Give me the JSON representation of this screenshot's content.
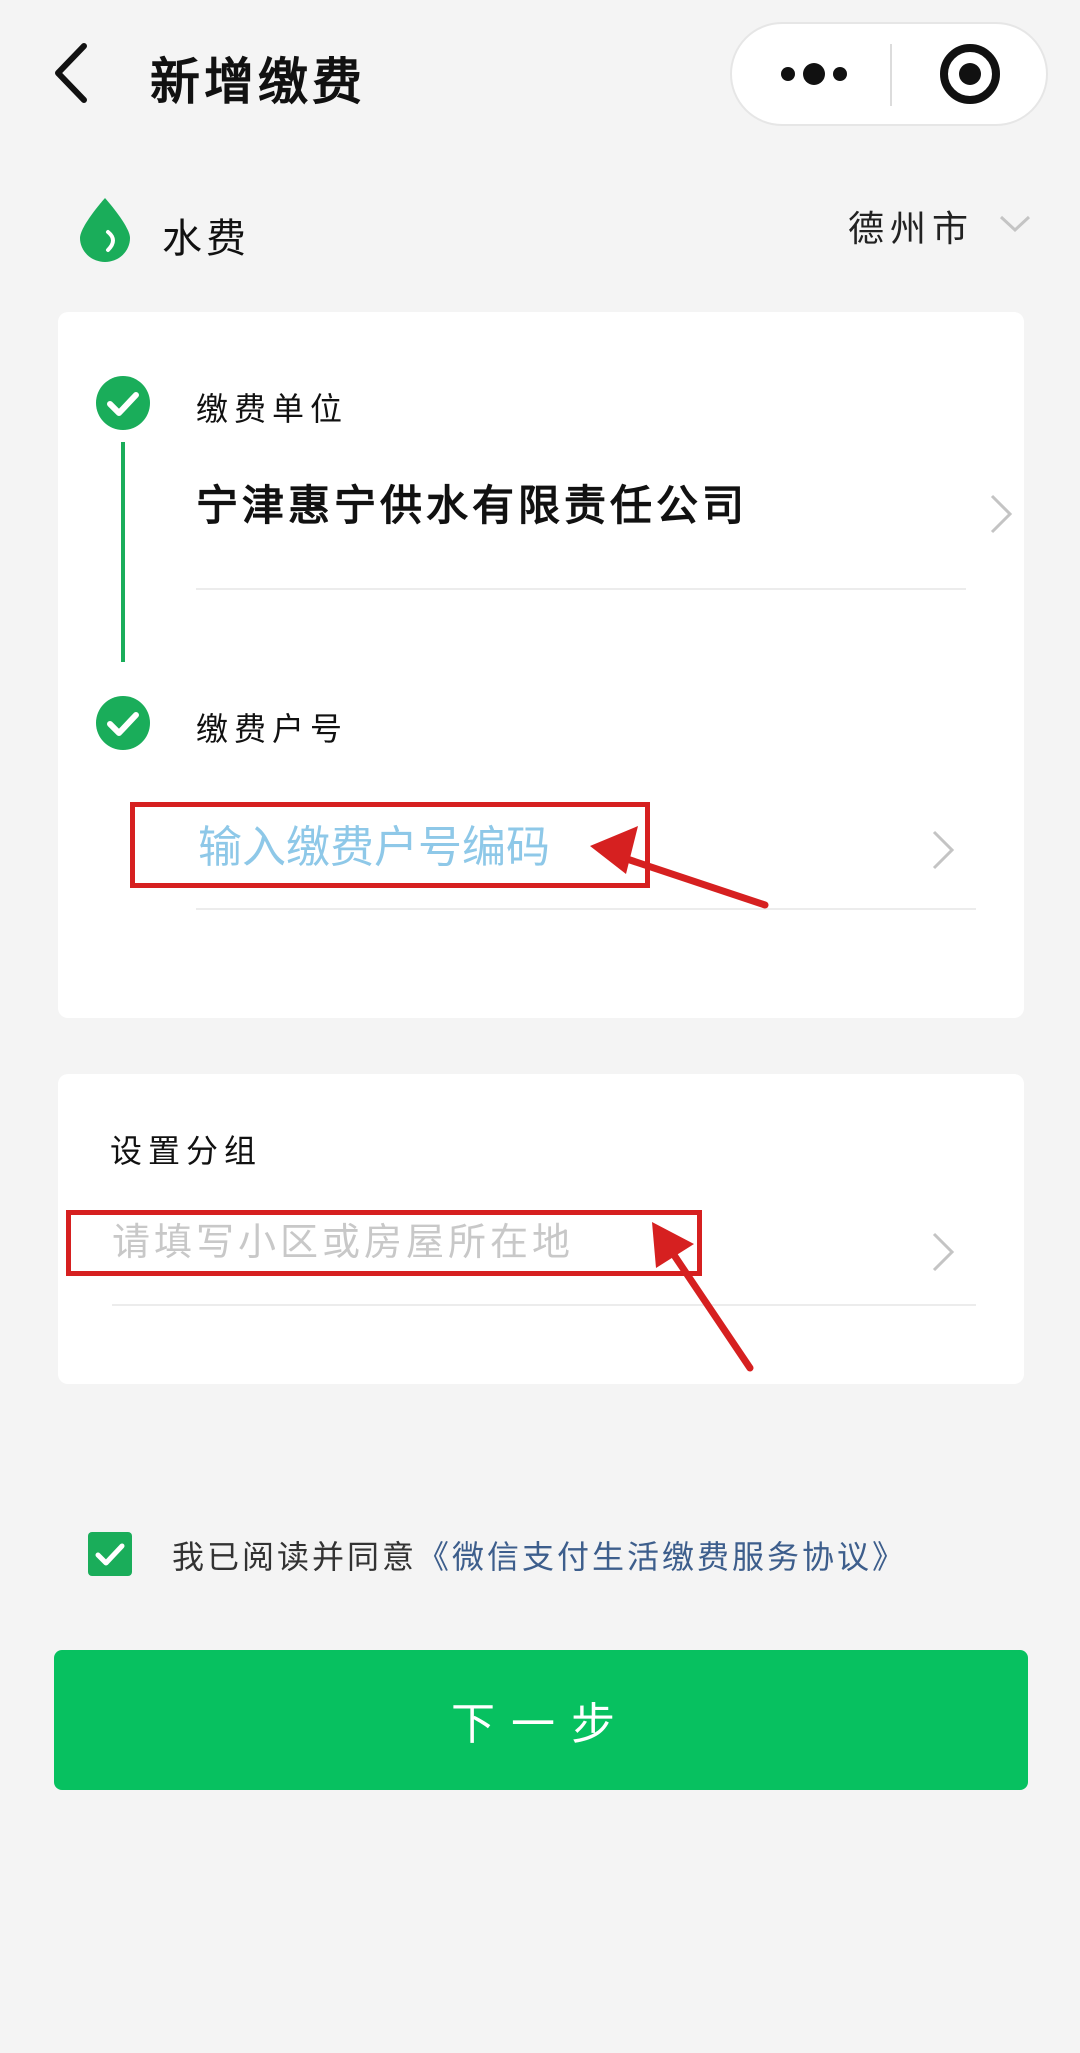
{
  "header": {
    "title": "新增缴费"
  },
  "service": {
    "name": "水费",
    "city": "德州市"
  },
  "steps": [
    {
      "label": "缴费单位",
      "value": "宁津惠宁供水有限责任公司"
    },
    {
      "label": "缴费户号",
      "placeholder": "输入缴费户号编码"
    }
  ],
  "group": {
    "label": "设置分组",
    "placeholder": "请填写小区或房屋所在地"
  },
  "agreement": {
    "prefix": "我已阅读并同意",
    "link": "《微信支付生活缴费服务协议》",
    "checked": true
  },
  "next_button": {
    "label": "下一步"
  },
  "colors": {
    "brand_green": "#07c160",
    "check_green": "#1aad5a",
    "annotation_red": "#d62020",
    "link_blue": "#3d5e8c"
  },
  "icons": [
    "back-arrow-icon",
    "more-dots-icon",
    "close-target-icon",
    "water-drop-icon",
    "chevron-down-icon",
    "chevron-right-icon",
    "checkmark-icon"
  ]
}
